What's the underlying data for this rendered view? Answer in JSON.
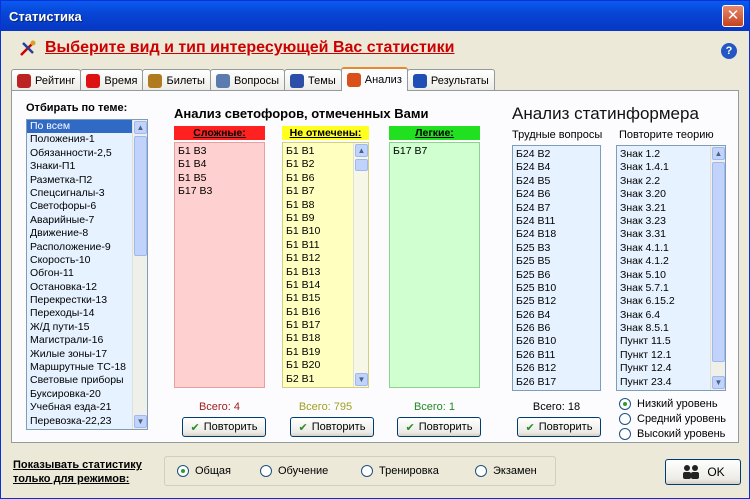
{
  "window": {
    "title": "Статистика",
    "close": "✕"
  },
  "heading": "Выберите вид и тип интересующей Вас статистики",
  "help": "?",
  "tabs": [
    {
      "label": "Рейтинг",
      "icon": "rating-icon",
      "color": "#b22"
    },
    {
      "label": "Время",
      "icon": "clock-icon",
      "color": "#d11"
    },
    {
      "label": "Билеты",
      "icon": "tickets-icon",
      "color": "#b07a20"
    },
    {
      "label": "Вопросы",
      "icon": "questions-icon",
      "color": "#5a7ab0"
    },
    {
      "label": "Темы",
      "icon": "topics-icon",
      "color": "#2c4da8"
    },
    {
      "label": "Анализ",
      "icon": "analysis-icon",
      "color": "#d9501a",
      "active": true
    },
    {
      "label": "Результаты",
      "icon": "results-icon",
      "color": "#1f4fb5"
    }
  ],
  "topic": {
    "label": "Отбирать по теме:",
    "items": [
      "По всем",
      "Положения-1",
      "Обязанности-2,5",
      "Знаки-П1",
      "Разметка-П2",
      "Спецсигналы-3",
      "Светофоры-6",
      "Аварийные-7",
      "Движение-8",
      "Расположение-9",
      "Скорость-10",
      "Обгон-11",
      "Остановка-12",
      "Перекрестки-13",
      "Переходы-14",
      "Ж/Д пути-15",
      "Магистрали-16",
      "Жилые зоны-17",
      "Маршрутные ТС-18",
      "Световые приборы",
      "Буксировка-20",
      "Учебная езда-21",
      "Перевозка-22,23"
    ],
    "selected": 0
  },
  "svetofor": {
    "title": "Анализ светофоров, отмеченных Вами",
    "hard": {
      "header": "Сложные:",
      "items": [
        "Б1 В3",
        "Б1 В4",
        "Б1 В5",
        "Б17 В3"
      ],
      "total": "Всего: 4",
      "color": "#ff2020",
      "bg": "#ffd0d0"
    },
    "none": {
      "header": "Не отмечены:",
      "items": [
        "Б1 В1",
        "Б1 В2",
        "Б1 В6",
        "Б1 В7",
        "Б1 В8",
        "Б1 В9",
        "Б1 В10",
        "Б1 В11",
        "Б1 В12",
        "Б1 В13",
        "Б1 В14",
        "Б1 В15",
        "Б1 В16",
        "Б1 В17",
        "Б1 В18",
        "Б1 В19",
        "Б1 В20",
        "Б2 В1"
      ],
      "total": "Всего: 795",
      "color": "#ffff20",
      "bg": "#ffffc0"
    },
    "easy": {
      "header": "Легкие:",
      "items": [
        "Б17 В7"
      ],
      "total": "Всего: 1",
      "color": "#20e020",
      "bg": "#d0ffd0"
    },
    "repeat": "Повторить"
  },
  "informer": {
    "title": "Анализ статинформера",
    "hard_label": "Трудные вопросы",
    "theory_label": "Повторите теорию",
    "hard_items": [
      "Б24 В2",
      "Б24 В4",
      "Б24 В5",
      "Б24 В6",
      "Б24 В7",
      "Б24 В11",
      "Б24 В18",
      "Б25 В3",
      "Б25 В5",
      "Б25 В6",
      "Б25 В10",
      "Б25 В12",
      "Б26 В4",
      "Б26 В6",
      "Б26 В10",
      "Б26 В11",
      "Б26 В12",
      "Б26 В17"
    ],
    "theory_items": [
      "Знак 1.2",
      "Знак 1.4.1",
      "Знак 2.2",
      "Знак 3.20",
      "Знак 3.21",
      "Знак 3.23",
      "Знак 3.31",
      "Знак 4.1.1",
      "Знак 4.1.2",
      "Знак 5.10",
      "Знак 5.7.1",
      "Знак 6.15.2",
      "Знак 6.4",
      "Знак 8.5.1",
      "Пункт 11.5",
      "Пункт 12.1",
      "Пункт 12.4",
      "Пункт 23.4"
    ],
    "total": "Всего: 18",
    "repeat": "Повторить",
    "levels": [
      "Низкий уровень",
      "Средний уровень",
      "Высокий уровень"
    ],
    "level_selected": 0
  },
  "modes": {
    "label_line1": "Показывать статистику",
    "label_line2": "только для режимов:",
    "options": [
      "Общая",
      "Обучение",
      "Тренировка",
      "Экзамен"
    ],
    "selected": 0
  },
  "ok": "OK"
}
